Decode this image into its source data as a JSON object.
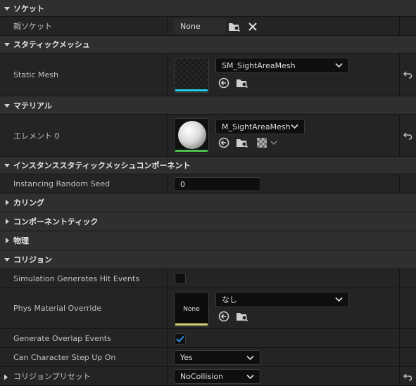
{
  "sections": {
    "socket": "ソケット",
    "static_mesh": "スタティックメッシュ",
    "material": "マテリアル",
    "instanced": "インスタンススタティックメッシュコンポーネント",
    "lod": "カリング",
    "component_tick": "コンポーネントティック",
    "physics": "物理",
    "collision": "コリジョン"
  },
  "socket": {
    "parent_label": "親ソケット",
    "parent_value": "None"
  },
  "static_mesh": {
    "label": "Static Mesh",
    "value": "SM_SightAreaMesh"
  },
  "material": {
    "label": "エレメント 0",
    "value": "M_SightAreaMesh"
  },
  "instanced": {
    "seed_label": "Instancing Random Seed",
    "seed_value": "0"
  },
  "collision": {
    "sim_hit_label": "Simulation Generates Hit Events",
    "sim_hit_checked": false,
    "phys_label": "Phys Material Override",
    "phys_thumb_text": "None",
    "phys_value": "なし",
    "overlap_label": "Generate Overlap Events",
    "overlap_checked": true,
    "step_label": "Can Character Step Up On",
    "step_value": "Yes",
    "preset_label": "コリジョンプリセット",
    "preset_value": "NoCollision"
  },
  "colors": {
    "mesh_bar": "#1fd0e6",
    "material_bar": "#4cbb4c",
    "phys_bar": "#d8d27a",
    "check_blue": "#2f86d8"
  }
}
